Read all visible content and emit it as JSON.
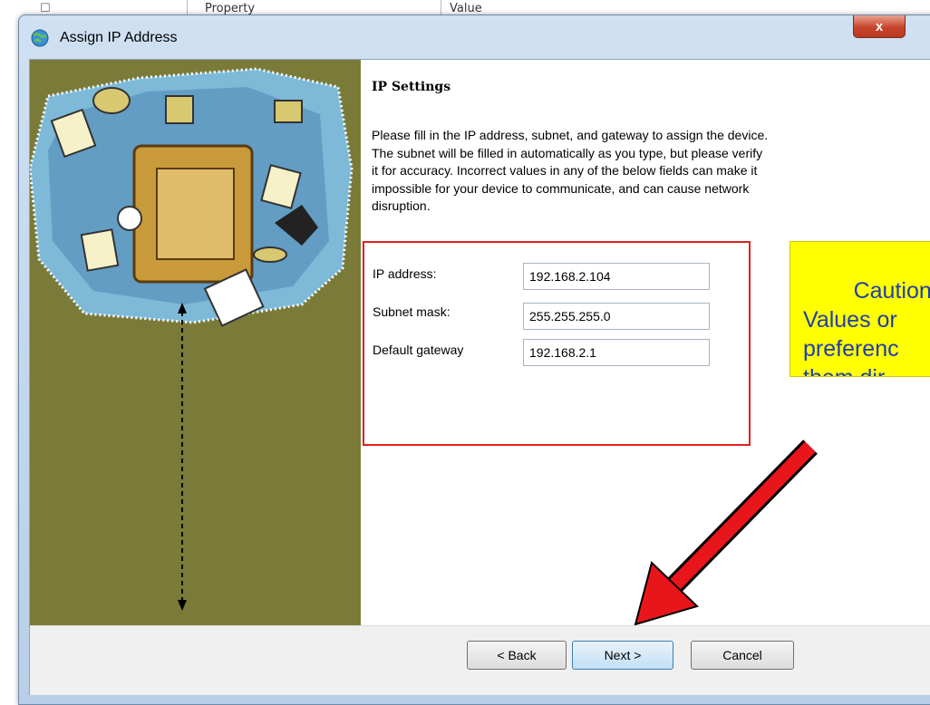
{
  "background_list": {
    "col1": "Property",
    "col2": "Value"
  },
  "window": {
    "title": "Assign IP Address",
    "close_label": "x",
    "app_icon": "network-globe-icon"
  },
  "content": {
    "heading": "IP Settings",
    "description": "Please fill in the IP address, subnet, and gateway to assign the device.\nThe subnet will be filled in automatically as you type, but please verify\nit for accuracy.  Incorrect values in any of the below fields can make it\nimpossible for your device to communicate, and can cause network\ndisruption.",
    "fields": [
      {
        "label": "IP address:",
        "value": "192.168.2.104"
      },
      {
        "label": "Subnet mask:",
        "value": "255.255.255.0"
      },
      {
        "label": "Default gateway",
        "value": "192.168.2.1"
      }
    ]
  },
  "annotation": {
    "caution_text": "Caution:\nValues or\npreferenc\nthem dir",
    "caution_color": "#ffff00",
    "highlight_color": "#e02020"
  },
  "footer": {
    "back_label": "< Back",
    "next_label": "Next >",
    "cancel_label": "Cancel"
  }
}
